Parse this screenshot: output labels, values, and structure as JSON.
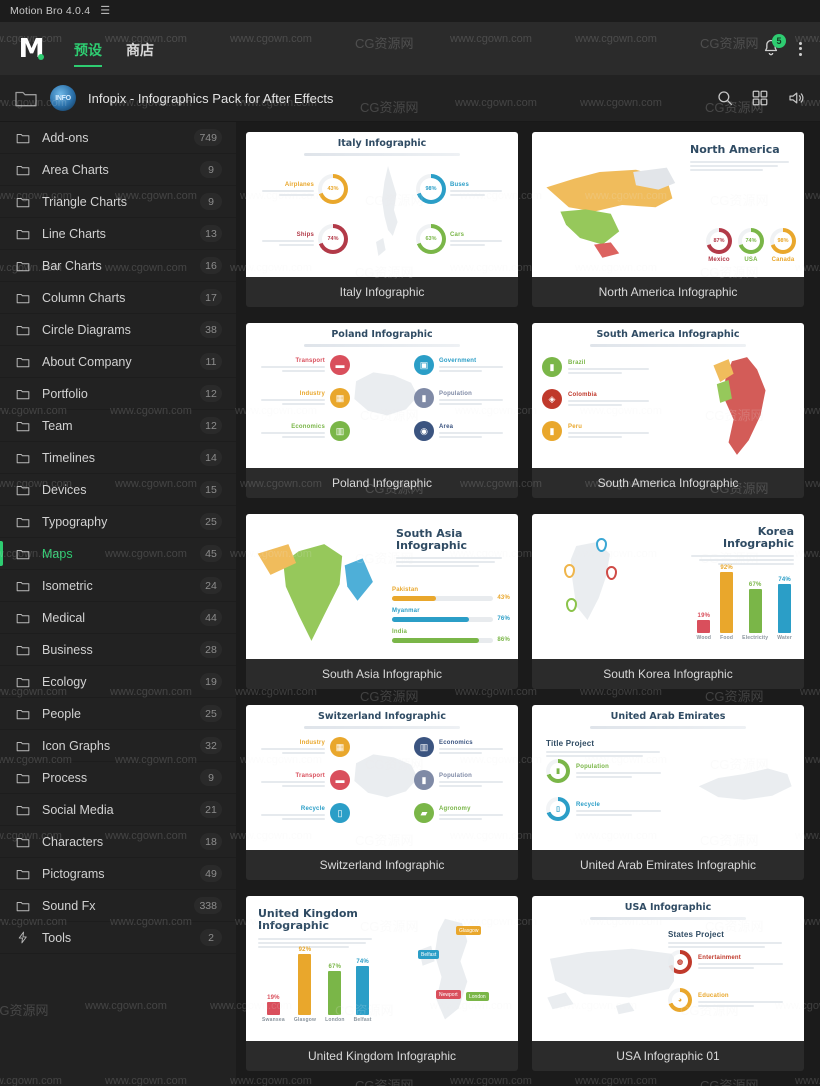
{
  "window": {
    "title": "Motion Bro 4.0.4",
    "menu_icon": "hamburger-icon"
  },
  "topnav": {
    "logo_letter": "M",
    "tabs": [
      {
        "label": "预设",
        "active": true
      },
      {
        "label": "商店",
        "active": false
      }
    ],
    "notification_count": "5",
    "bell_icon": "bell-icon",
    "overflow_icon": "kebab-menu-icon"
  },
  "breadcrumb": {
    "folder_icon": "folder-icon",
    "thumb_label": "INFO",
    "title": "Infopix - Infographics Pack for After Effects",
    "actions": [
      {
        "name": "search-icon",
        "label": "Search"
      },
      {
        "name": "grid-view-icon",
        "label": "Grid view"
      },
      {
        "name": "sound-icon",
        "label": "Sound"
      }
    ]
  },
  "sidebar": {
    "items": [
      {
        "label": "Add-ons",
        "count": "749",
        "icon": "folder-icon",
        "active": false
      },
      {
        "label": "Area Charts",
        "count": "9",
        "icon": "folder-icon",
        "active": false
      },
      {
        "label": "Triangle Charts",
        "count": "9",
        "icon": "folder-icon",
        "active": false
      },
      {
        "label": "Line Charts",
        "count": "13",
        "icon": "folder-icon",
        "active": false
      },
      {
        "label": "Bar Charts",
        "count": "16",
        "icon": "folder-icon",
        "active": false
      },
      {
        "label": "Column Charts",
        "count": "17",
        "icon": "folder-icon",
        "active": false
      },
      {
        "label": "Circle Diagrams",
        "count": "38",
        "icon": "folder-icon",
        "active": false
      },
      {
        "label": "About Company",
        "count": "11",
        "icon": "folder-icon",
        "active": false
      },
      {
        "label": "Portfolio",
        "count": "12",
        "icon": "folder-icon",
        "active": false
      },
      {
        "label": "Team",
        "count": "12",
        "icon": "folder-icon",
        "active": false
      },
      {
        "label": "Timelines",
        "count": "14",
        "icon": "folder-icon",
        "active": false
      },
      {
        "label": "Devices",
        "count": "15",
        "icon": "folder-icon",
        "active": false
      },
      {
        "label": "Typography",
        "count": "25",
        "icon": "folder-icon",
        "active": false
      },
      {
        "label": "Maps",
        "count": "45",
        "icon": "folder-icon",
        "active": true
      },
      {
        "label": "Isometric",
        "count": "24",
        "icon": "folder-icon",
        "active": false
      },
      {
        "label": "Medical",
        "count": "44",
        "icon": "folder-icon",
        "active": false
      },
      {
        "label": "Business",
        "count": "28",
        "icon": "folder-icon",
        "active": false
      },
      {
        "label": "Ecology",
        "count": "19",
        "icon": "folder-icon",
        "active": false
      },
      {
        "label": "People",
        "count": "25",
        "icon": "folder-icon",
        "active": false
      },
      {
        "label": "Icon Graphs",
        "count": "32",
        "icon": "folder-icon",
        "active": false
      },
      {
        "label": "Process",
        "count": "9",
        "icon": "folder-icon",
        "active": false
      },
      {
        "label": "Social Media",
        "count": "21",
        "icon": "folder-icon",
        "active": false
      },
      {
        "label": "Characters",
        "count": "18",
        "icon": "folder-icon",
        "active": false
      },
      {
        "label": "Pictograms",
        "count": "49",
        "icon": "folder-icon",
        "active": false
      },
      {
        "label": "Sound Fx",
        "count": "338",
        "icon": "folder-icon",
        "active": false
      },
      {
        "label": "Tools",
        "count": "2",
        "icon": "lightning-icon",
        "active": false
      }
    ]
  },
  "gallery": {
    "cards": [
      {
        "caption": "Italy Infographic",
        "thumb": {
          "title": "Italy Infographic",
          "layout": "donuts-around-map",
          "items": [
            {
              "label": "Airplanes",
              "value": "43%",
              "color": "#e9a72c"
            },
            {
              "label": "Buses",
              "value": "98%",
              "color": "#2b9ec7"
            },
            {
              "label": "Ships",
              "value": "74%",
              "color": "#b23a48"
            },
            {
              "label": "Cars",
              "value": "63%",
              "color": "#7ab648"
            }
          ]
        }
      },
      {
        "caption": "North America Infographic",
        "thumb": {
          "title": "North America",
          "layout": "map-left-donuts-right",
          "items": [
            {
              "label": "Mexico",
              "value": "87%",
              "color": "#b23a48"
            },
            {
              "label": "USA",
              "value": "74%",
              "color": "#7ab648"
            },
            {
              "label": "Canada",
              "value": "98%",
              "color": "#e9a72c"
            }
          ]
        }
      },
      {
        "caption": "Poland Infographic",
        "thumb": {
          "title": "Poland Infographic",
          "layout": "icons-around-map",
          "items": [
            {
              "label": "Transport",
              "color": "#d94f5c",
              "icon": "bus-icon",
              "side": "left"
            },
            {
              "label": "Industry",
              "color": "#e9a72c",
              "icon": "factory-icon",
              "side": "left"
            },
            {
              "label": "Economics",
              "color": "#7ab648",
              "icon": "chart-icon",
              "side": "left"
            },
            {
              "label": "Government",
              "color": "#2b9ec7",
              "icon": "bank-icon",
              "side": "right"
            },
            {
              "label": "Population",
              "color": "#7f8aa6",
              "icon": "people-icon",
              "side": "right"
            },
            {
              "label": "Area",
              "color": "#3b5480",
              "icon": "map-pin-icon",
              "side": "right"
            }
          ]
        }
      },
      {
        "caption": "South America Infographic",
        "thumb": {
          "title": "South America Infographic",
          "layout": "icons-left-map-right",
          "items": [
            {
              "label": "Brazil",
              "color": "#7ab648",
              "icon": "people-icon"
            },
            {
              "label": "Colombia",
              "color": "#c0392b",
              "icon": "drop-icon"
            },
            {
              "label": "Peru",
              "color": "#e9a72c",
              "icon": "person-icon"
            }
          ]
        }
      },
      {
        "caption": "South Asia Infographic",
        "thumb": {
          "title": "South Asia Infographic",
          "layout": "map-left-hbars-right",
          "items": [
            {
              "label": "Pakistan",
              "value": "43%",
              "color": "#e9a72c",
              "pct": 43
            },
            {
              "label": "Myanmar",
              "value": "76%",
              "color": "#2b9ec7",
              "pct": 76
            },
            {
              "label": "India",
              "value": "86%",
              "color": "#7ab648",
              "pct": 86
            }
          ]
        }
      },
      {
        "caption": "South Korea Infographic",
        "thumb": {
          "title": "Korea Infographic",
          "layout": "map-pins-left-vbars-right",
          "items": [
            {
              "label": "Wood",
              "value": "19%",
              "color": "#d94f5c",
              "pct": 19
            },
            {
              "label": "Food",
              "value": "92%",
              "color": "#e9a72c",
              "pct": 92
            },
            {
              "label": "Electricity",
              "value": "67%",
              "color": "#7ab648",
              "pct": 67
            },
            {
              "label": "Water",
              "value": "74%",
              "color": "#2b9ec7",
              "pct": 74
            }
          ]
        }
      },
      {
        "caption": "Switzerland Infographic",
        "thumb": {
          "title": "Switzerland Infographic",
          "layout": "icons-around-map",
          "items": [
            {
              "label": "Industry",
              "color": "#e9a72c",
              "icon": "factory-icon",
              "side": "left"
            },
            {
              "label": "Transport",
              "color": "#d94f5c",
              "icon": "bus-icon",
              "side": "left"
            },
            {
              "label": "Recycle",
              "color": "#2b9ec7",
              "icon": "recycle-icon",
              "side": "left"
            },
            {
              "label": "Economics",
              "color": "#3b5480",
              "icon": "chart-icon",
              "side": "right"
            },
            {
              "label": "Population",
              "color": "#7f8aa6",
              "icon": "people-icon",
              "side": "right"
            },
            {
              "label": "Agronomy",
              "color": "#7ab648",
              "icon": "leaf-icon",
              "side": "right"
            }
          ]
        }
      },
      {
        "caption": "United Arab Emirates Infographic",
        "thumb": {
          "title": "United Arab Emirates",
          "subtitle": "Title Project",
          "layout": "list-left-map-right",
          "items": [
            {
              "label": "Population",
              "color": "#7ab648",
              "icon": "people-icon"
            },
            {
              "label": "Recycle",
              "color": "#2b9ec7",
              "icon": "recycle-icon"
            }
          ]
        }
      },
      {
        "caption": "United Kingdom Infographic",
        "thumb": {
          "title": "United Kingdom Infographic",
          "layout": "vbars-left-map-right",
          "items": [
            {
              "label": "Swansea",
              "value": "19%",
              "color": "#d94f5c",
              "pct": 19
            },
            {
              "label": "Glasgow",
              "value": "92%",
              "color": "#e9a72c",
              "pct": 92
            },
            {
              "label": "London",
              "value": "67%",
              "color": "#7ab648",
              "pct": 67
            },
            {
              "label": "Belfast",
              "value": "74%",
              "color": "#2b9ec7",
              "pct": 74
            }
          ],
          "map_labels": [
            {
              "label": "Glasgow",
              "color": "#e9a72c"
            },
            {
              "label": "Belfast",
              "color": "#2b9ec7"
            },
            {
              "label": "Newport",
              "color": "#d94f5c"
            },
            {
              "label": "London",
              "color": "#7ab648"
            }
          ]
        }
      },
      {
        "caption": "USA Infographic 01",
        "thumb": {
          "title": "USA Infographic",
          "subtitle": "States Project",
          "layout": "map-left-list-right",
          "items": [
            {
              "label": "Entertainment",
              "color": "#c0392b",
              "icon": "bike-icon"
            },
            {
              "label": "Education",
              "color": "#e9a72c",
              "icon": "cap-icon"
            }
          ]
        }
      }
    ]
  },
  "watermark": {
    "latin": "www.cgown.com",
    "chinese": "CG资源网"
  },
  "colors": {
    "accent": "#2ecc71",
    "app_bg": "#1b1b1b",
    "panel_bg": "#222222",
    "card_bg": "#2b2b2b"
  }
}
